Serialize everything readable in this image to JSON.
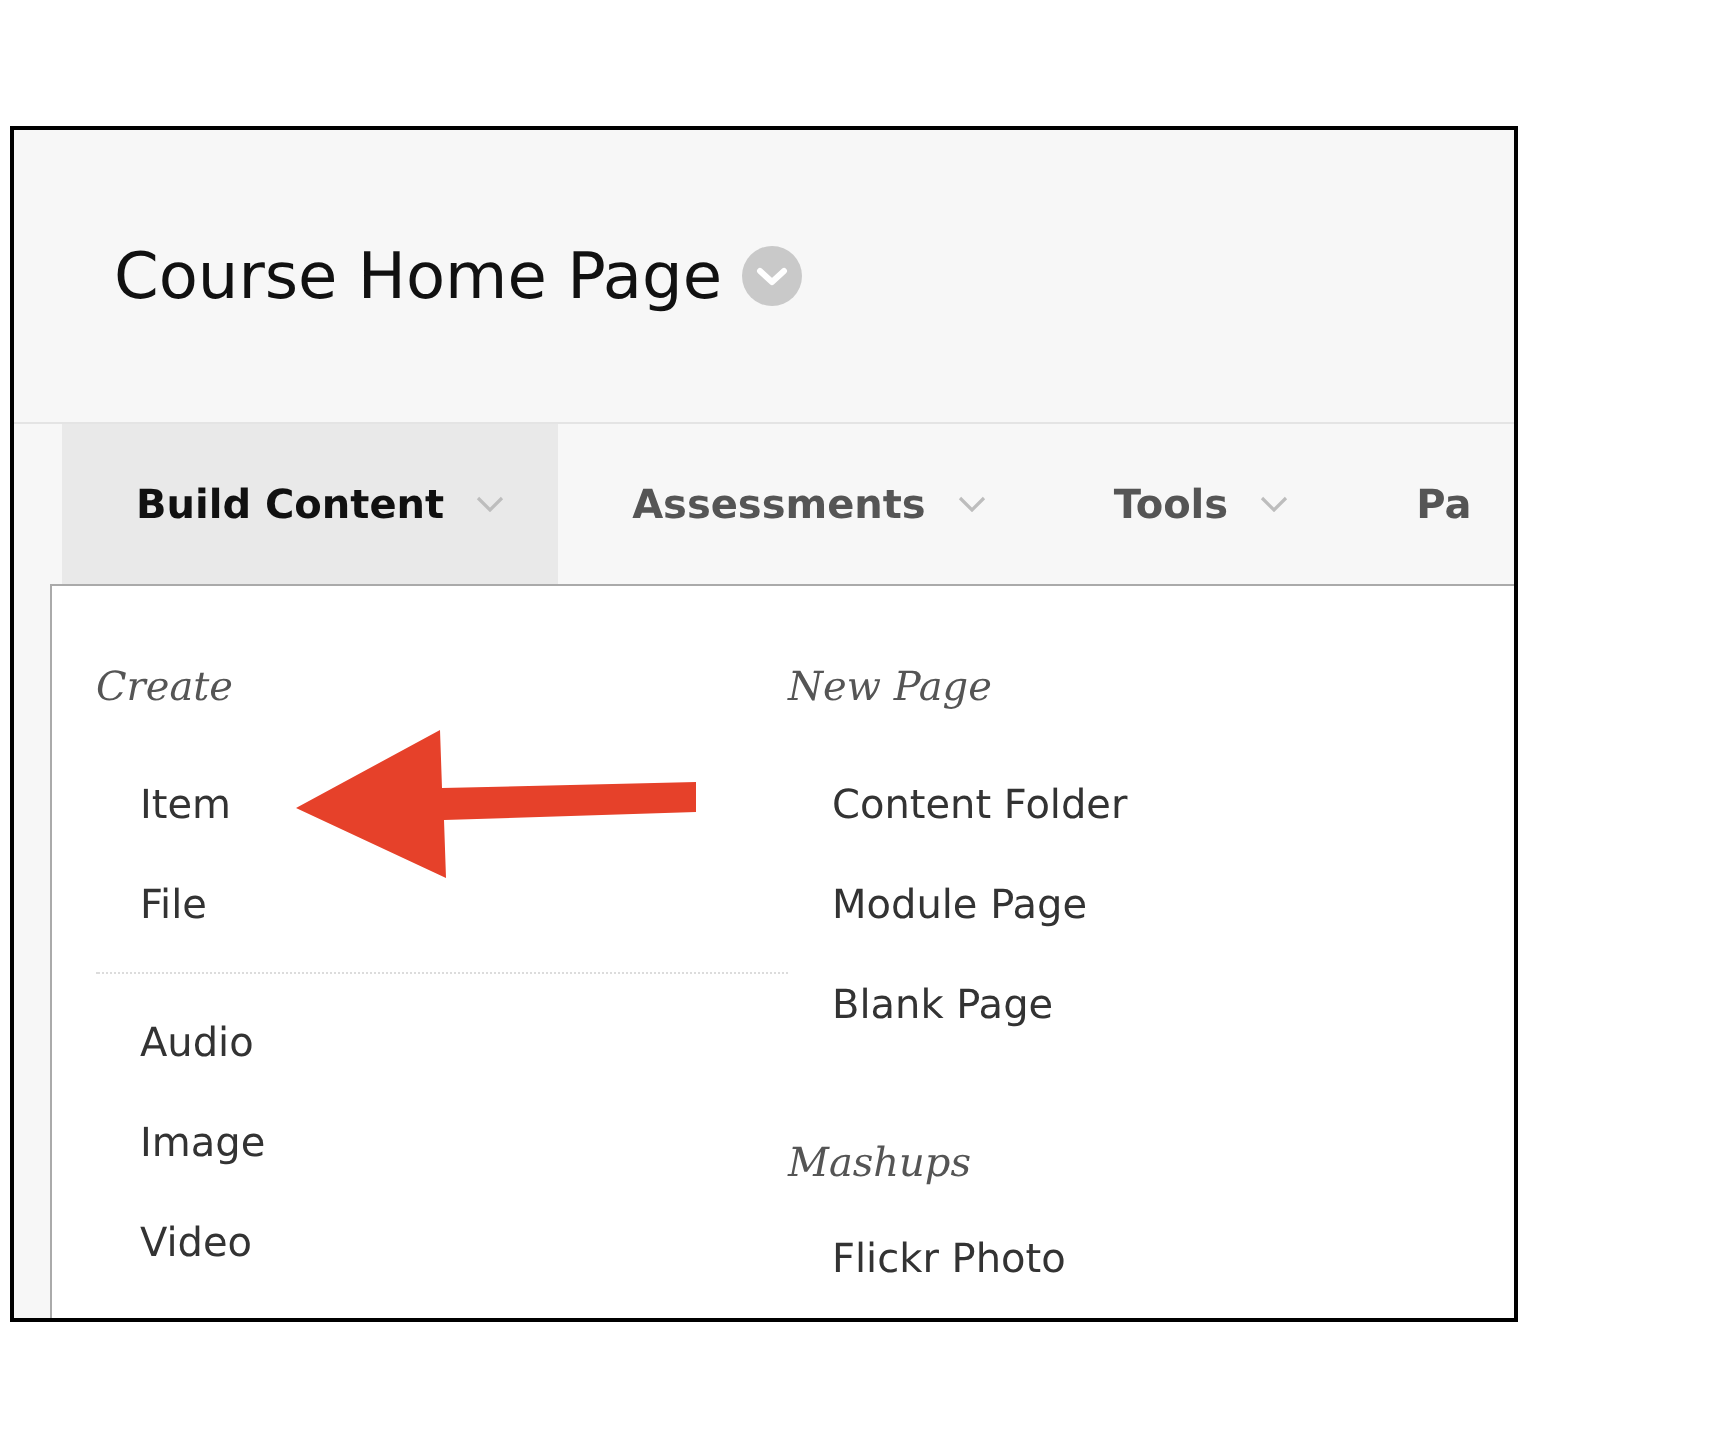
{
  "header": {
    "title": "Course Home Page"
  },
  "tabs": [
    {
      "label": "Build Content",
      "selected": true,
      "caret": true
    },
    {
      "label": "Assessments",
      "selected": false,
      "caret": true
    },
    {
      "label": "Tools",
      "selected": false,
      "caret": true
    },
    {
      "label": "Pa",
      "selected": false,
      "caret": false
    }
  ],
  "dropdown": {
    "columns": [
      {
        "sections": [
          {
            "heading": "Create",
            "groups": [
              {
                "items": [
                  {
                    "label": "Item",
                    "arrow": true
                  },
                  {
                    "label": "File",
                    "arrow": false
                  }
                ]
              },
              {
                "items": [
                  {
                    "label": "Audio",
                    "arrow": false
                  },
                  {
                    "label": "Image",
                    "arrow": false
                  },
                  {
                    "label": "Video",
                    "arrow": false
                  }
                ]
              }
            ]
          }
        ]
      },
      {
        "sections": [
          {
            "heading": "New Page",
            "groups": [
              {
                "items": [
                  {
                    "label": "Content Folder",
                    "arrow": false
                  },
                  {
                    "label": "Module Page",
                    "arrow": false
                  },
                  {
                    "label": "Blank Page",
                    "arrow": false
                  }
                ]
              }
            ]
          },
          {
            "heading": "Mashups",
            "groups": [
              {
                "items": [
                  {
                    "label": "Flickr Photo",
                    "arrow": false
                  }
                ]
              }
            ]
          }
        ]
      }
    ]
  }
}
